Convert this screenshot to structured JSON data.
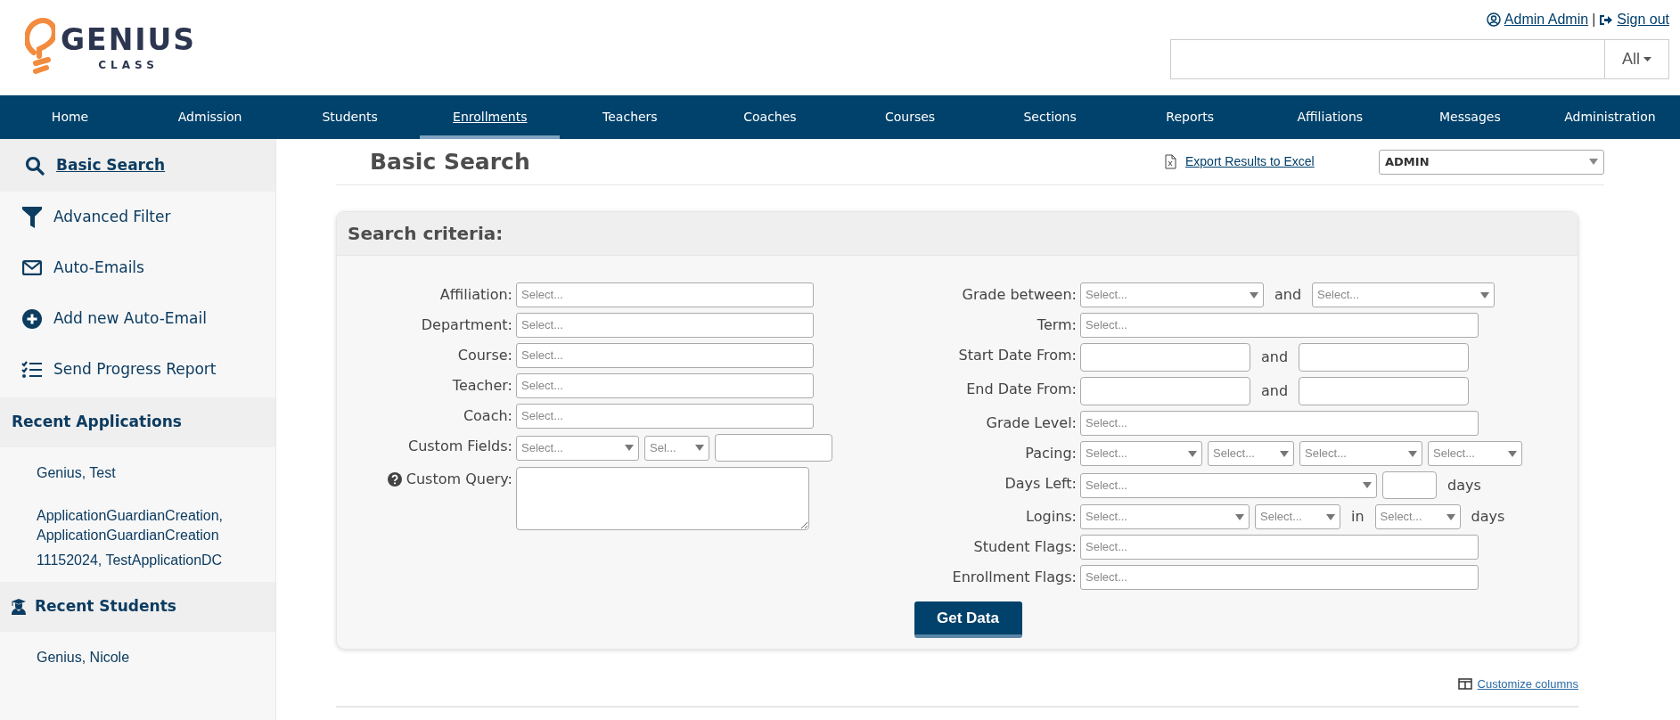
{
  "logo": {
    "name": "GENIUS",
    "tagline": "CLASS"
  },
  "user_menu": {
    "user": "Admin Admin",
    "separator": "|",
    "sign_out": "Sign out"
  },
  "search": {
    "scope": "All"
  },
  "nav": [
    {
      "label": "Home",
      "selected": false
    },
    {
      "label": "Admission",
      "selected": false
    },
    {
      "label": "Students",
      "selected": false
    },
    {
      "label": "Enrollments",
      "selected": true
    },
    {
      "label": "Teachers",
      "selected": false
    },
    {
      "label": "Coaches",
      "selected": false
    },
    {
      "label": "Courses",
      "selected": false
    },
    {
      "label": "Sections",
      "selected": false
    },
    {
      "label": "Reports",
      "selected": false
    },
    {
      "label": "Affiliations",
      "selected": false
    },
    {
      "label": "Messages",
      "selected": false
    },
    {
      "label": "Administration",
      "selected": false
    }
  ],
  "sidebar": {
    "items": [
      {
        "label": "Basic Search",
        "selected": true
      },
      {
        "label": "Advanced Filter",
        "selected": false
      },
      {
        "label": "Auto-Emails",
        "selected": false
      },
      {
        "label": "Add new Auto-Email",
        "selected": false
      },
      {
        "label": "Send Progress Report",
        "selected": false
      }
    ],
    "sections": [
      {
        "title": "Recent Applications",
        "items": [
          "Genius, Test",
          "ApplicationGuardianCreation, ApplicationGuardianCreation",
          "11152024, TestApplicationDC"
        ]
      },
      {
        "title": "Recent Students",
        "items": [
          "Genius, Nicole"
        ]
      }
    ]
  },
  "page_title": "Basic Search",
  "export_link": "Export Results to Excel",
  "role_select": {
    "value": "ADMIN"
  },
  "search_criteria": {
    "title": "Search criteria:",
    "left_fields": [
      {
        "label": "Affiliation:",
        "controls": [
          {
            "kind": "multiselect",
            "placeholder": "Select..."
          }
        ]
      },
      {
        "label": "Department:",
        "controls": [
          {
            "kind": "multiselect",
            "placeholder": "Select..."
          }
        ]
      },
      {
        "label": "Course:",
        "controls": [
          {
            "kind": "multiselect",
            "placeholder": "Select..."
          }
        ]
      },
      {
        "label": "Teacher:",
        "controls": [
          {
            "kind": "multiselect",
            "placeholder": "Select..."
          }
        ]
      },
      {
        "label": "Coach:",
        "controls": [
          {
            "kind": "multiselect",
            "placeholder": "Select..."
          }
        ]
      },
      {
        "label": "Custom Fields:",
        "controls": [
          {
            "kind": "dropdown",
            "placeholder": "Select..."
          },
          {
            "kind": "dropdown",
            "placeholder": "Sel..."
          },
          {
            "kind": "text"
          }
        ]
      },
      {
        "label": "Custom Query:",
        "controls": [
          {
            "kind": "textarea"
          }
        ]
      }
    ],
    "right_fields": [
      {
        "label": "Grade between:",
        "controls": [
          {
            "kind": "dropdown",
            "placeholder": "Select..."
          },
          {
            "kind": "word",
            "text": "and"
          },
          {
            "kind": "dropdown",
            "placeholder": "Select..."
          }
        ]
      },
      {
        "label": "Term:",
        "controls": [
          {
            "kind": "multiselect",
            "placeholder": "Select..."
          }
        ]
      },
      {
        "label": "Start Date From:",
        "controls": [
          {
            "kind": "date"
          },
          {
            "kind": "word",
            "text": "and"
          },
          {
            "kind": "date"
          }
        ]
      },
      {
        "label": "End Date From:",
        "controls": [
          {
            "kind": "date"
          },
          {
            "kind": "word",
            "text": "and"
          },
          {
            "kind": "date"
          }
        ]
      },
      {
        "label": "Grade Level:",
        "controls": [
          {
            "kind": "multiselect",
            "placeholder": "Select..."
          }
        ]
      },
      {
        "label": "Pacing:",
        "controls": [
          {
            "kind": "dropdown",
            "placeholder": "Select..."
          },
          {
            "kind": "dropdown",
            "placeholder": "Select..."
          },
          {
            "kind": "dropdown",
            "placeholder": "Select..."
          },
          {
            "kind": "dropdown",
            "placeholder": "Select..."
          }
        ]
      },
      {
        "label": "Days Left:",
        "controls": [
          {
            "kind": "dropdown",
            "placeholder": "Select..."
          },
          {
            "kind": "text"
          },
          {
            "kind": "word",
            "text": "days"
          }
        ]
      },
      {
        "label": "Logins:",
        "controls": [
          {
            "kind": "dropdown",
            "placeholder": "Select..."
          },
          {
            "kind": "dropdown",
            "placeholder": "Select..."
          },
          {
            "kind": "word",
            "text": "in"
          },
          {
            "kind": "dropdown",
            "placeholder": "Select..."
          },
          {
            "kind": "word",
            "text": "days"
          }
        ]
      },
      {
        "label": "Student Flags:",
        "controls": [
          {
            "kind": "multiselect",
            "placeholder": "Select..."
          }
        ]
      },
      {
        "label": "Enrollment Flags:",
        "controls": [
          {
            "kind": "multiselect",
            "placeholder": "Select..."
          }
        ]
      }
    ]
  },
  "submit": "Get Data",
  "customize_columns": "Customize columns"
}
